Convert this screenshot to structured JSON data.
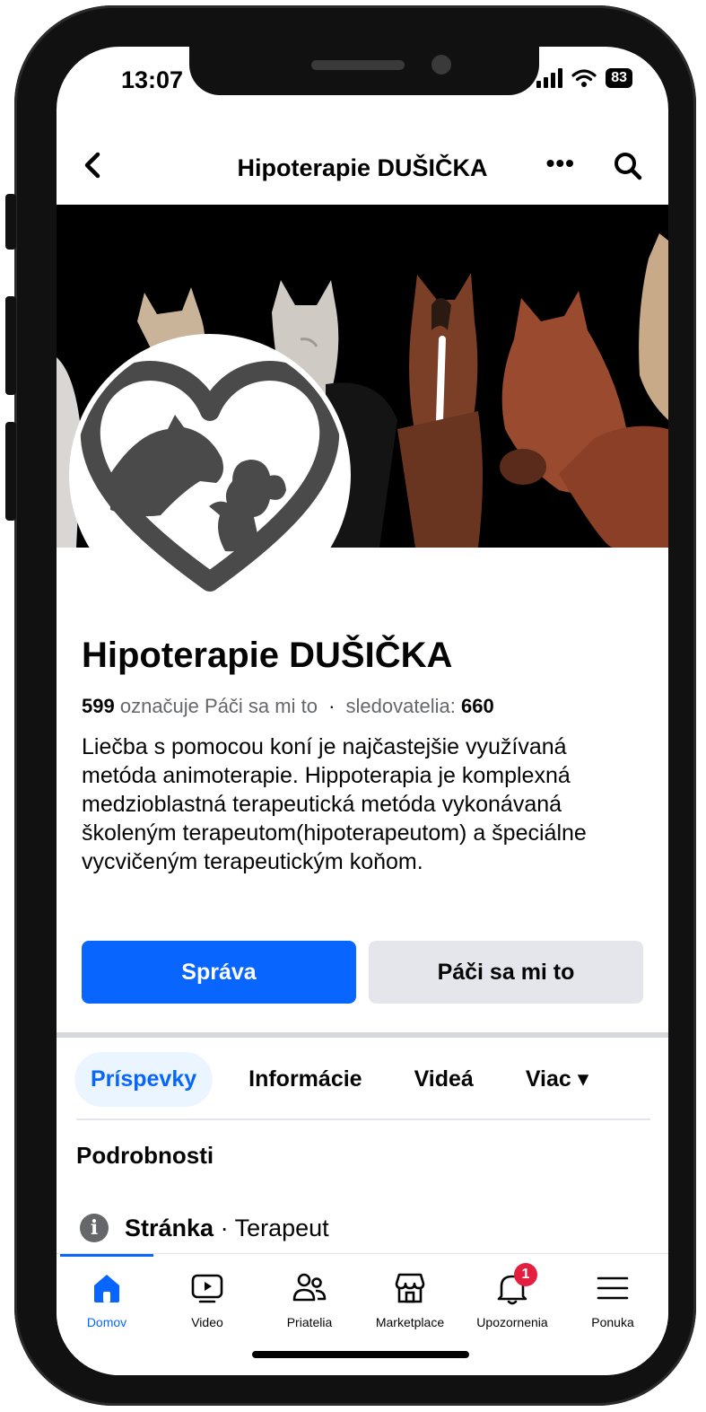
{
  "status": {
    "time": "13:07",
    "battery": "83"
  },
  "topbar": {
    "back_label": "<",
    "title": "Hipoterapie DUŠIČKA",
    "more_label": "•••"
  },
  "profile": {
    "name": "Hipoterapie DUŠIČKA",
    "likes_count": "599",
    "likes_label": "označuje Páči sa mi to",
    "dot": "·",
    "followers_label": "sledovatelia:",
    "followers_count": "660",
    "about": "Liečba s pomocou koní je najčastejšie využívaná metóda animoterapie. Hippoterapia je komplexná medzioblastná terapeutická metóda vykonávaná školeným terapeutom(hipoterapeutom) a špeciálne vycvičeným terapeutickým koňom."
  },
  "actions": {
    "message_label": "Správa",
    "like_label": "Páči sa mi to"
  },
  "tabs": [
    {
      "label": "Príspevky"
    },
    {
      "label": "Informácie"
    },
    {
      "label": "Videá"
    },
    {
      "label": "Viac ▾"
    }
  ],
  "details": {
    "title": "Podrobnosti",
    "row_bold": "Stránka",
    "row_rest": " · Terapeut"
  },
  "nav": [
    {
      "label": "Domov",
      "icon": "home-icon"
    },
    {
      "label": "Video",
      "icon": "video-icon"
    },
    {
      "label": "Priatelia",
      "icon": "friends-icon"
    },
    {
      "label": "Marketplace",
      "icon": "marketplace-icon"
    },
    {
      "label": "Upozornenia",
      "icon": "bell-icon",
      "badge": "1"
    },
    {
      "label": "Ponuka",
      "icon": "menu-icon"
    }
  ],
  "colors": {
    "accent": "#0866ff",
    "badge": "#e41e3f",
    "secondary_button": "#e4e6eb"
  }
}
